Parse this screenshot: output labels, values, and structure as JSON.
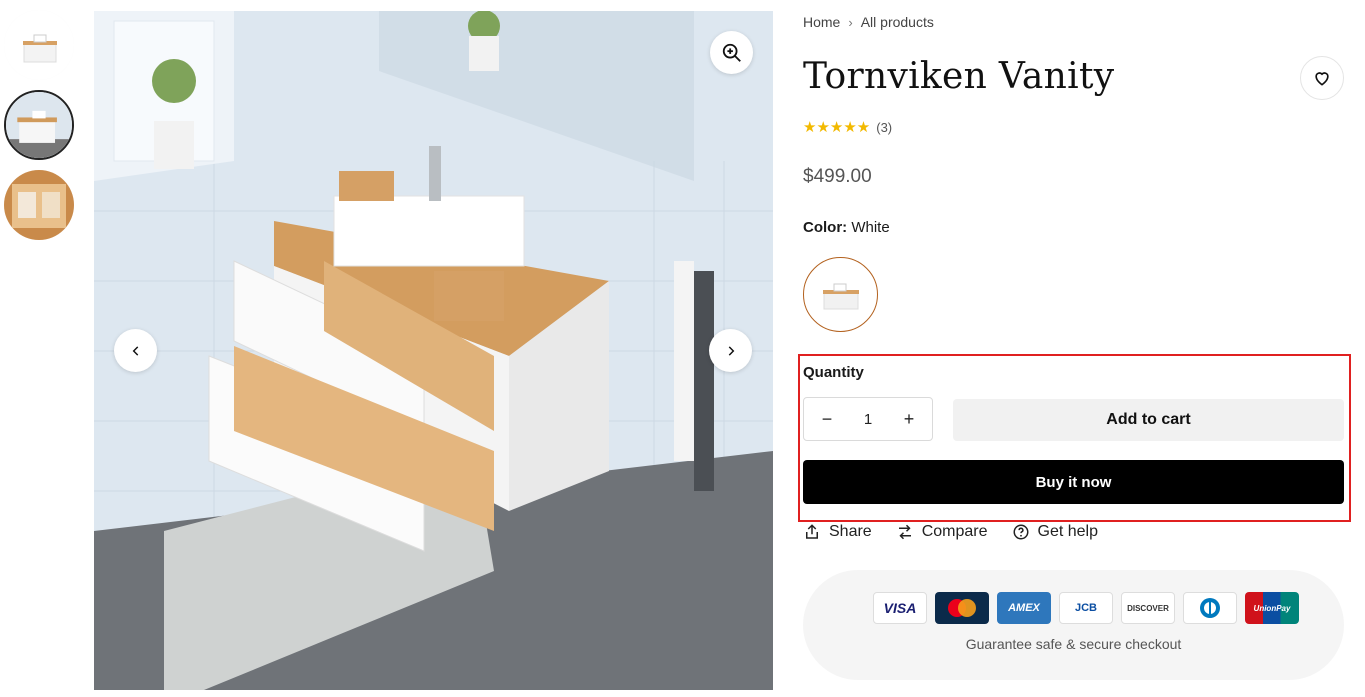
{
  "breadcrumb": {
    "home": "Home",
    "separator": "›",
    "current": "All products"
  },
  "product": {
    "title": "Tornviken Vanity",
    "rating_stars": "★★★★★",
    "rating_count": "(3)",
    "price": "$499.00",
    "color_label": "Color:",
    "color_value": "White"
  },
  "purchase": {
    "quantity_label": "Quantity",
    "quantity_value": "1",
    "decrement": "−",
    "increment": "+",
    "add_to_cart": "Add to cart",
    "buy_now": "Buy it now"
  },
  "actions": {
    "share": "Share",
    "compare": "Compare",
    "help": "Get help"
  },
  "checkout": {
    "cards": [
      "VISA",
      "MC",
      "AMEX",
      "JCB",
      "DISCOVER",
      "DC",
      "UnionPay"
    ],
    "secure_text": "Guarantee safe & secure checkout"
  },
  "colors": {
    "accent_swatch_border": "#b3611e",
    "highlight_box": "#e02020",
    "stars": "#f2b900"
  }
}
